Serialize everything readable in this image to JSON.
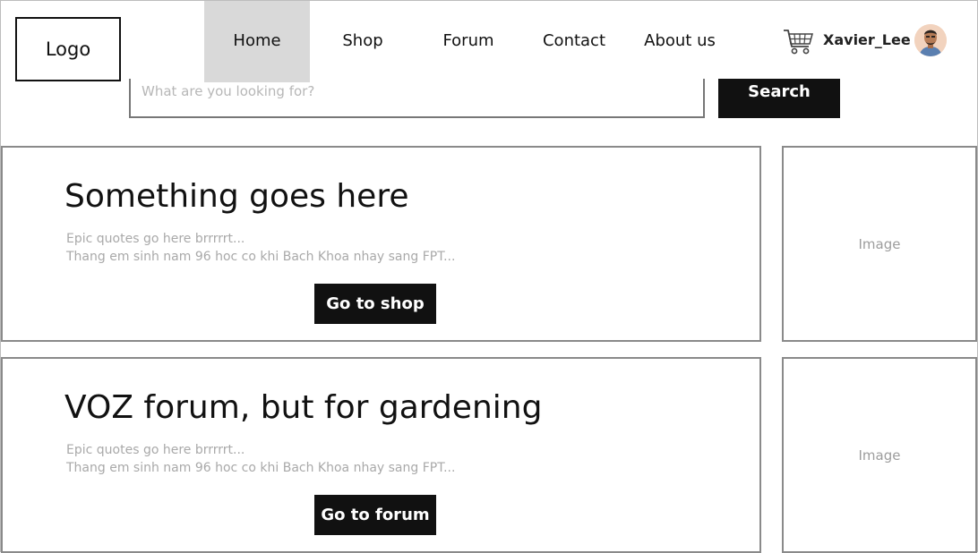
{
  "header": {
    "logo": "Logo",
    "nav": [
      {
        "label": "Home",
        "active": true
      },
      {
        "label": "Shop",
        "active": false
      },
      {
        "label": "Forum",
        "active": false
      },
      {
        "label": "Contact",
        "active": false
      },
      {
        "label": "About us",
        "active": false
      }
    ],
    "cart_icon": "shopping-cart-icon",
    "username": "Xavier_Lee",
    "avatar_icon": "user-avatar"
  },
  "search": {
    "placeholder": "What are you looking for?",
    "button_label": "Search"
  },
  "sections": [
    {
      "title": "Something goes here",
      "quote_line1": "Epic quotes go here brrrrrt...",
      "quote_line2": "Thang em sinh nam 96 hoc co khi Bach Khoa nhay sang FPT...",
      "button_label": "Go to shop",
      "image_label": "Image"
    },
    {
      "title": "VOZ forum, but for gardening",
      "quote_line1": "Epic quotes go here brrrrrt...",
      "quote_line2": "Thang em sinh nam 96 hoc co khi Bach Khoa nhay sang FPT...",
      "button_label": "Go to forum",
      "image_label": "Image"
    }
  ],
  "colors": {
    "nav_active_bg": "#d9d9d9",
    "button_bg": "#111111",
    "muted_text": "#a9a9a9",
    "border": "#8a8a8a"
  }
}
